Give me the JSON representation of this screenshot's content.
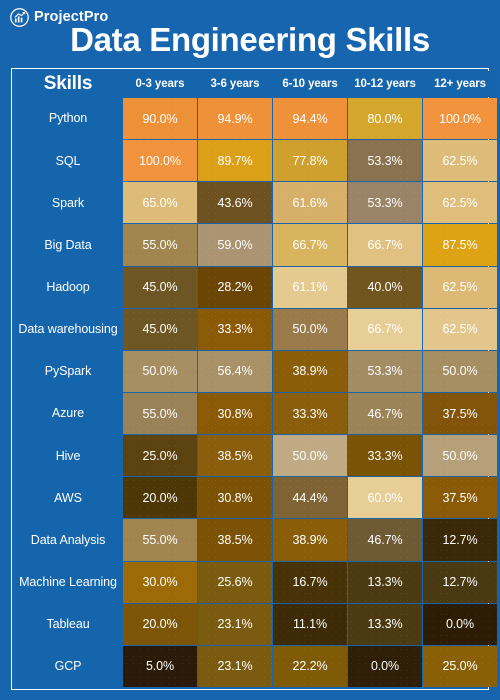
{
  "brand": {
    "name": "ProjectPro",
    "logo_icon": "growth-chart-circle-icon"
  },
  "header": {
    "title": "Data Engineering Skills"
  },
  "colors": {
    "background_blue": "#1765AF",
    "cell_blue": "#1565AD",
    "grid_white": "#FFFFFF",
    "heat_high": "#F0933C",
    "heat_mid": "#D9B45E",
    "heat_low": "#2B1A08",
    "text_white": "#FFFFFF"
  },
  "chart_data": {
    "type": "heatmap",
    "title": "Data Engineering Skills",
    "xlabel": "",
    "ylabel": "Skills",
    "legend": null,
    "grid": true,
    "value_suffix": "%",
    "value_range": [
      0.0,
      100.0
    ],
    "categories": [
      "0-3 years",
      "3-6 years",
      "6-10 years",
      "10-12 years",
      "12+ years"
    ],
    "row_header": "Skills",
    "rows": [
      "Python",
      "SQL",
      "Spark",
      "Big Data",
      "Hadoop",
      "Data warehousing",
      "PySpark",
      "Azure",
      "Hive",
      "AWS",
      "Data Analysis",
      "Machine Learning",
      "Tableau",
      "GCP"
    ],
    "values": [
      [
        90.0,
        94.9,
        94.4,
        80.0,
        100.0
      ],
      [
        100.0,
        89.7,
        77.8,
        53.3,
        62.5
      ],
      [
        65.0,
        43.6,
        61.6,
        53.3,
        62.5
      ],
      [
        55.0,
        59.0,
        66.7,
        66.7,
        87.5
      ],
      [
        45.0,
        28.2,
        61.1,
        40.0,
        62.5
      ],
      [
        45.0,
        33.3,
        50.0,
        66.7,
        62.5
      ],
      [
        50.0,
        56.4,
        38.9,
        53.3,
        50.0
      ],
      [
        55.0,
        30.8,
        33.3,
        46.7,
        37.5
      ],
      [
        25.0,
        38.5,
        50.0,
        33.3,
        50.0
      ],
      [
        20.0,
        30.8,
        44.4,
        60.0,
        37.5
      ],
      [
        55.0,
        38.5,
        38.9,
        46.7,
        12.7
      ],
      [
        30.0,
        25.6,
        16.7,
        13.3,
        12.7
      ],
      [
        20.0,
        23.1,
        11.1,
        13.3,
        0.0
      ],
      [
        5.0,
        23.1,
        22.2,
        0.0,
        25.0
      ]
    ],
    "cell_colors": [
      [
        "#ED9139",
        "#EE9139",
        "#EE9139",
        "#D4A62C",
        "#F0933C"
      ],
      [
        "#F0933C",
        "#DBA018",
        "#CFA02E",
        "#8A7250",
        "#DDBC79"
      ],
      [
        "#DDBC79",
        "#6E5221",
        "#D6B069",
        "#9A8467",
        "#DFBE7B"
      ],
      [
        "#A0854F",
        "#AA9471",
        "#D9B45E",
        "#E0C182",
        "#DDA312"
      ],
      [
        "#6E5524",
        "#6B4505",
        "#E5CA90",
        "#71551F",
        "#DCBA76"
      ],
      [
        "#6E5524",
        "#8A5A06",
        "#9A7A4A",
        "#E7CD96",
        "#E3C68B"
      ],
      [
        "#A68E63",
        "#A89166",
        "#8A5D09",
        "#A28C63",
        "#A68E63"
      ],
      [
        "#9A8258",
        "#8A5A06",
        "#8A5E0D",
        "#9B8458",
        "#81540A"
      ],
      [
        "#5C420F",
        "#8A5E0D",
        "#C0AA84",
        "#7A5305",
        "#B6A079"
      ],
      [
        "#4E3707",
        "#7C5306",
        "#7F6334",
        "#E7CD96",
        "#8A5A06"
      ],
      [
        "#A0854F",
        "#7C5306",
        "#8A5D09",
        "#6E5A33",
        "#3A2806"
      ],
      [
        "#9C6A06",
        "#7A5B10",
        "#483208",
        "#4B3A12",
        "#4A3A14"
      ],
      [
        "#7C5606",
        "#7A5B10",
        "#3D2A07",
        "#4B3A12",
        "#2E1D05"
      ],
      [
        "#2B1A08",
        "#7A5B10",
        "#7F5A07",
        "#2F1F06",
        "#8A6006"
      ]
    ]
  }
}
